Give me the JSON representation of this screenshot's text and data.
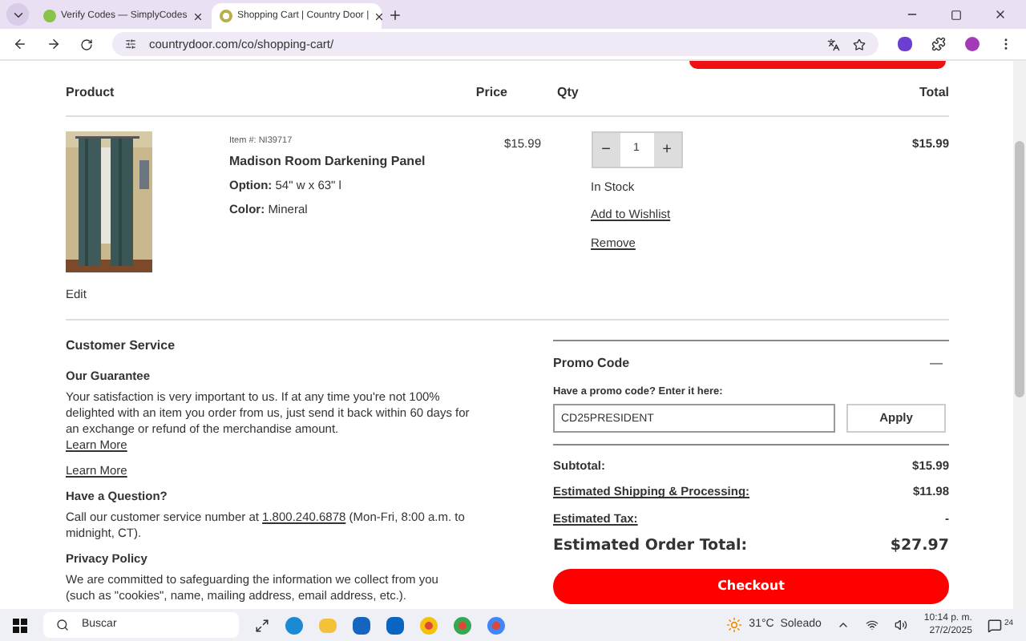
{
  "browser": {
    "tabs": [
      {
        "title": "Verify Codes — SimplyCodes",
        "selected": false
      },
      {
        "title": "Shopping Cart | Country Door |",
        "selected": true
      }
    ],
    "address": "countrydoor.com/co/shopping-cart/"
  },
  "cart": {
    "columns": [
      "Product",
      "Price",
      "Qty",
      "Total"
    ],
    "items": [
      {
        "item_no": "Item #: NI39717",
        "name": "Madison Room Darkening Panel",
        "option_label": "Option:",
        "option": "54\" w x 63\" l",
        "color_label": "Color:",
        "color_name": "Mineral",
        "price": "$15.99",
        "qty": "1",
        "minus": "−",
        "plus": "+",
        "stock": "In Stock",
        "wishlist": "Add to Wishlist",
        "remove": "Remove",
        "total": "$15.99",
        "edit": "Edit"
      }
    ]
  },
  "customer_service": {
    "title": "Customer Service",
    "sections": [
      {
        "heading": "Our Guarantee",
        "text": "Your satisfaction is very important to us. If at any time you're not 100% delighted with an item you order from us, just send it back within 60 days for an exchange or refund of the merchandise amount.",
        "link": "Learn More"
      },
      {
        "link": "Learn More"
      },
      {
        "heading": "Have a Question?",
        "text_before": "Call our customer service number at ",
        "phone": "1.800.240.6878",
        "text_after": " (Mon-Fri, 8:00 a.m. to midnight, CT)."
      },
      {
        "heading": "Privacy Policy",
        "text": "We are committed to safeguarding the information we collect from you (such as \"cookies\", name, mailing address, email address, etc.)."
      }
    ]
  },
  "promo": {
    "title": "Promo Code",
    "expanded": true,
    "collapse": "—",
    "label": "Have a promo code? Enter it here:",
    "value": "CD25PRESIDENT",
    "button": "Apply"
  },
  "summary": {
    "rows": [
      {
        "label": "Subtotal:",
        "value": "$15.99",
        "link": false
      },
      {
        "label": "Estimated Shipping & Processing:",
        "value": "$11.98",
        "link": true
      },
      {
        "label": "Estimated Tax:",
        "value": "-",
        "link": true
      }
    ],
    "total_label": "Estimated Order Total:",
    "total": "$27.97",
    "checkout": "Checkout"
  },
  "taskbar": {
    "search": "Buscar",
    "weather": "31°C  Soleado",
    "time": "10:14 p. m.",
    "date": "27/2/2025",
    "notifications": "24"
  }
}
